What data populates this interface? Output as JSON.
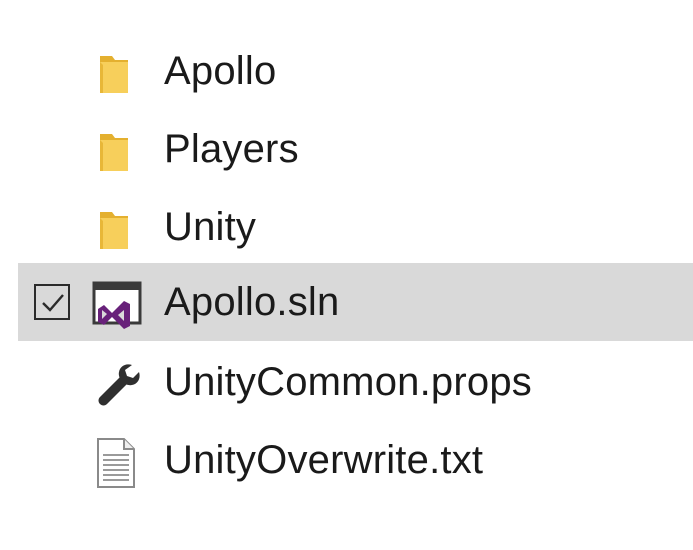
{
  "file_list": {
    "items": [
      {
        "name": "Apollo",
        "icon": "folder-icon",
        "selected": false
      },
      {
        "name": "Players",
        "icon": "folder-icon",
        "selected": false
      },
      {
        "name": "Unity",
        "icon": "folder-icon",
        "selected": false
      },
      {
        "name": "Apollo.sln",
        "icon": "visual-studio-solution-icon",
        "selected": true,
        "checked": true
      },
      {
        "name": "UnityCommon.props",
        "icon": "wrench-icon",
        "selected": false
      },
      {
        "name": "UnityOverwrite.txt",
        "icon": "text-document-icon",
        "selected": false
      }
    ]
  },
  "colors": {
    "folder": "#f5c842",
    "selection_background": "#d9d9d9",
    "visual_studio_purple": "#68217a"
  }
}
